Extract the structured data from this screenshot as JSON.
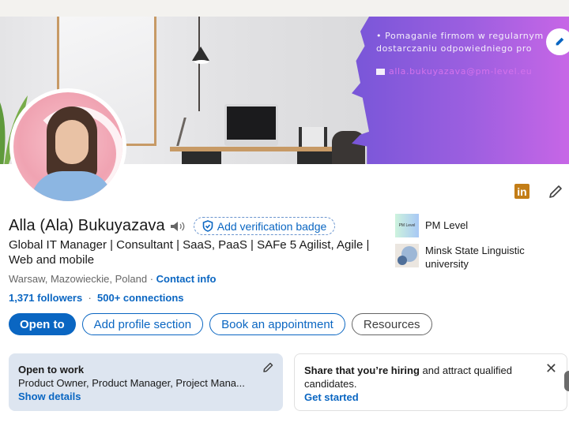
{
  "banner": {
    "text_lines": [
      "• Pomaganie firmom w regularnym",
      "dostarczaniu odpowiedniego pro"
    ],
    "email": "alla.bukuyazava@pm-level.eu",
    "colors": {
      "purple_start": "#7856d8",
      "purple_end": "#c766e6",
      "email": "#d472ec"
    }
  },
  "profile": {
    "name": "Alla (Ala) Bukuyazava",
    "verification_label": "Add verification badge",
    "headline": "Global IT Manager | Consultant | SaaS, PaaS | SAFe 5 Agilist, Agile | Web and mobile",
    "location": "Warsaw, Mazowieckie, Poland",
    "separator": " · ",
    "contact_info": "Contact info",
    "followers": "1,371 followers",
    "connections": "500+ connections"
  },
  "top_icons": {
    "linkedin_label": "in"
  },
  "experience": [
    {
      "name": "PM Level",
      "logo_text": "PM Level"
    },
    {
      "name": "Minsk State Linguistic university"
    }
  ],
  "actions": {
    "open_to": "Open to",
    "add_section": "Add profile section",
    "book": "Book an appointment",
    "resources": "Resources"
  },
  "open_to_work": {
    "title": "Open to work",
    "roles": "Product Owner, Product Manager, Project Mana...",
    "link": "Show details"
  },
  "hiring": {
    "bold": "Share that you’re hiring",
    "rest": " and attract qualified candidates.",
    "link": "Get started",
    "close": "✕"
  },
  "colors": {
    "brand": "#0a66c2",
    "linkedin_badge": "#c37d16",
    "otw_card": "#dde5f0"
  }
}
